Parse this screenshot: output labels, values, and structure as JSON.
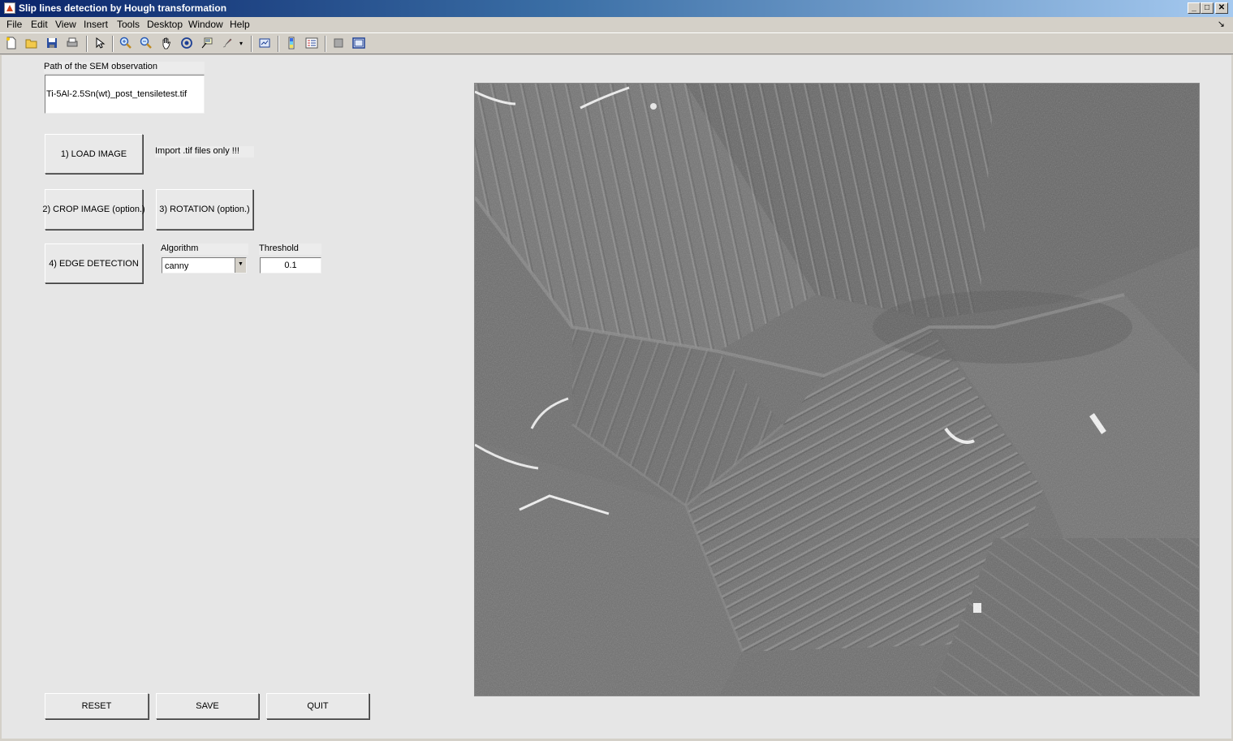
{
  "window": {
    "title": "Slip lines detection by Hough transformation",
    "controls": {
      "minimize": "_",
      "maximize": "□",
      "close": "✕"
    }
  },
  "menu": [
    "File",
    "Edit",
    "View",
    "Insert",
    "Tools",
    "Desktop",
    "Window",
    "Help"
  ],
  "menu_dock_icon": "↘",
  "toolbar_icons": [
    "new-figure-icon",
    "open-file-icon",
    "save-icon",
    "print-icon",
    "edit-plot-arrow-icon",
    "zoom-in-icon",
    "zoom-out-icon",
    "pan-hand-icon",
    "rotate-3d-icon",
    "data-cursor-icon",
    "brush-icon",
    "brush-dropdown-icon",
    "link-plot-icon",
    "insert-colorbar-icon",
    "insert-legend-icon",
    "hide-plot-tools-icon",
    "show-plot-tools-icon"
  ],
  "panel": {
    "path_label": "Path of the SEM observation",
    "path_value": "Ti-5Al-2.5Sn(wt)_post_tensiletest.tif",
    "load_button": "1) LOAD IMAGE",
    "import_note": "Import .tif files only !!!",
    "crop_button": "2) CROP IMAGE (option.)",
    "rotation_button": "3) ROTATION (option.)",
    "edge_button": "4) EDGE DETECTION",
    "algorithm_label": "Algorithm",
    "algorithm_value": "canny",
    "threshold_label": "Threshold",
    "threshold_value": "0.1"
  },
  "bottom_buttons": {
    "reset": "RESET",
    "save": "SAVE",
    "quit": "QUIT"
  },
  "image": {
    "description_name": "sem-micrograph"
  }
}
